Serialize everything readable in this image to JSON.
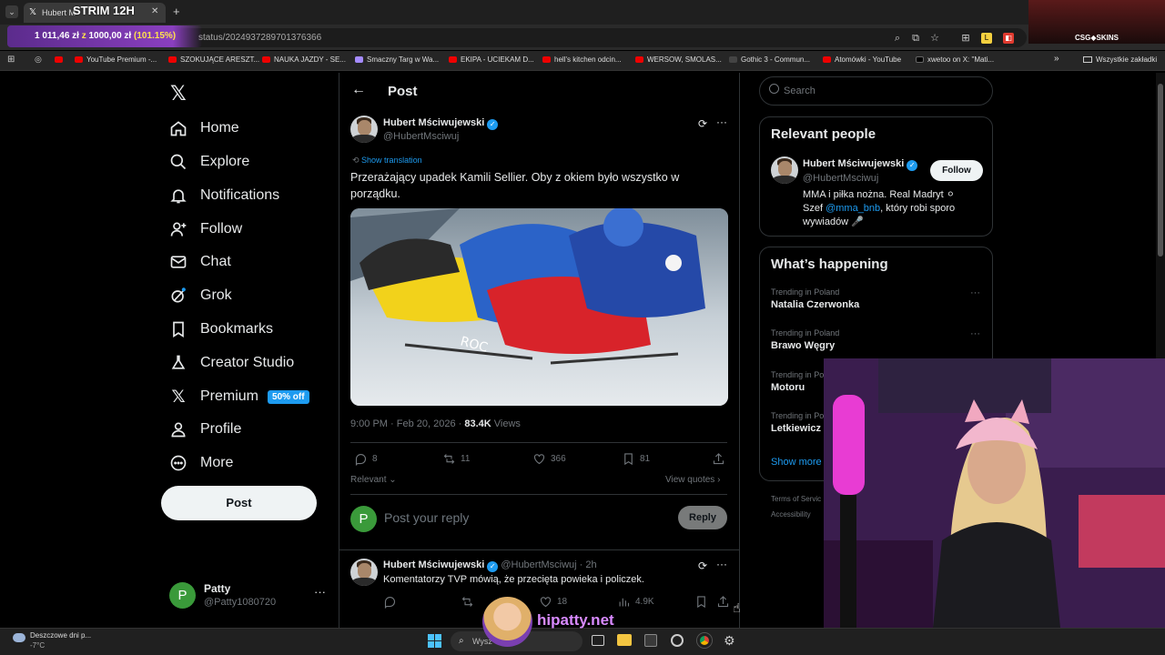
{
  "browser": {
    "tab_title": "Hubert M",
    "overlay_title": "STRIM 12H",
    "url": "status/2024937289701376366",
    "donation": {
      "amount": "1 011,46 zł",
      "z": "z",
      "goal": "1000,00 zł",
      "percent": "(101.15%)"
    },
    "sponsor": "CSG◆SKINS",
    "bookmarks": [
      "YouTube Premium -...",
      "SZOKUJĄCE ARESZT...",
      "NAUKA JAZDY - SE...",
      "Smaczny Targ w Wa...",
      "EKIPA - UCIEKAM D...",
      "hell's kitchen odcin...",
      "WERSOW, SMOLAS...",
      "Gothic 3 - Commun...",
      "Atomówki - YouTube",
      "xwetoo on X: \"Mati..."
    ],
    "all_bookmarks": "Wszystkie zakładki"
  },
  "nav": {
    "items": [
      {
        "label": "Home",
        "icon": "home-icon"
      },
      {
        "label": "Explore",
        "icon": "search-icon"
      },
      {
        "label": "Notifications",
        "icon": "bell-icon"
      },
      {
        "label": "Follow",
        "icon": "add-person-icon"
      },
      {
        "label": "Chat",
        "icon": "mail-icon"
      },
      {
        "label": "Grok",
        "icon": "grok-icon"
      },
      {
        "label": "Bookmarks",
        "icon": "bookmark-icon"
      },
      {
        "label": "Creator Studio",
        "icon": "flask-icon"
      },
      {
        "label": "Premium",
        "icon": "x-logo-icon"
      },
      {
        "label": "Profile",
        "icon": "person-icon"
      },
      {
        "label": "More",
        "icon": "more-circle-icon"
      }
    ],
    "premium_badge": "50% off",
    "post_button": "Post",
    "account": {
      "name": "Patty",
      "handle": "@Patty1080720",
      "initial": "P"
    }
  },
  "post": {
    "header": "Post",
    "author": "Hubert Mściwujewski",
    "handle": "@HubertMsciwuj",
    "show_translation": "Show translation",
    "text": "Przerażający upadek Kamili Sellier. Oby z okiem było wszystko w porządku.",
    "time": "9:00 PM · Feb 20, 2026 · ",
    "views_count": "83.4K",
    "views_label": " Views",
    "replies": "8",
    "reposts": "11",
    "likes": "366",
    "bookmarks": "81",
    "sort": "Relevant",
    "view_quotes": "View quotes",
    "reply_placeholder": "Post your reply",
    "reply_button": "Reply",
    "reply_avatar": "P"
  },
  "reply_tweet": {
    "author": "Hubert Mściwujewski",
    "handle": "@HubertMsciwuj · 2h",
    "text": "Komentatorzy TVP mówią, że przecięta powieka i policzek.",
    "likes": "18",
    "views": "4.9K"
  },
  "sidebar": {
    "search_placeholder": "Search",
    "relevant_title": "Relevant people",
    "person": {
      "name": "Hubert Mściwujewski",
      "handle": "@HubertMsciwuj",
      "follow": "Follow",
      "bio_line1": "MMA i piłka nożna. Real Madryt ⚪",
      "bio_szef": "Szef ",
      "bio_link": "@mma_bnb",
      "bio_rest": ", który robi sporo",
      "bio_line3": "wywiadów 🎤"
    },
    "happening_title": "What’s happening",
    "trends": [
      {
        "context": "Trending in Poland",
        "name": "Natalia Czerwonka"
      },
      {
        "context": "Trending in Poland",
        "name": "Brawo Węgry"
      },
      {
        "context": "Trending in Po",
        "name": "Motoru"
      },
      {
        "context": "Trending in Po",
        "name": "Letkiewicz"
      }
    ],
    "show_more": "Show more",
    "footer1": "Terms of Servic",
    "footer2": "Accessibility"
  },
  "stream": {
    "watermark": "hipatty.net"
  },
  "taskbar": {
    "weather_title": "Deszczowe dni p...",
    "weather_temp": "-7°C",
    "search": "Wysz"
  }
}
